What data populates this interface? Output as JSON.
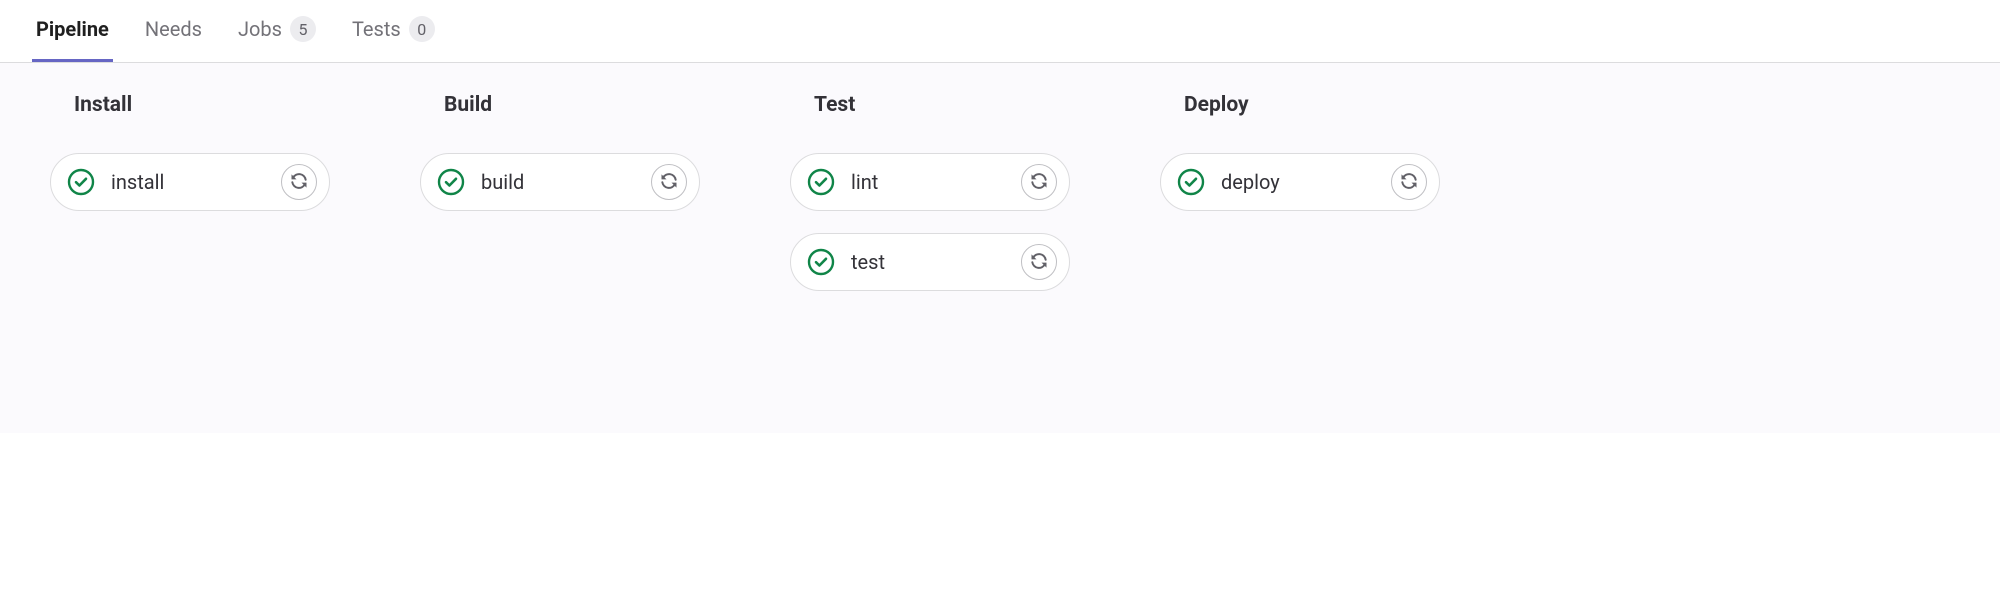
{
  "tabs": [
    {
      "label": "Pipeline",
      "active": true,
      "badge": null
    },
    {
      "label": "Needs",
      "active": false,
      "badge": null
    },
    {
      "label": "Jobs",
      "active": false,
      "badge": "5"
    },
    {
      "label": "Tests",
      "active": false,
      "badge": "0"
    }
  ],
  "stages": [
    {
      "name": "Install",
      "jobs": [
        {
          "name": "install",
          "status": "success"
        }
      ]
    },
    {
      "name": "Build",
      "jobs": [
        {
          "name": "build",
          "status": "success"
        }
      ]
    },
    {
      "name": "Test",
      "jobs": [
        {
          "name": "lint",
          "status": "success"
        },
        {
          "name": "test",
          "status": "success"
        }
      ]
    },
    {
      "name": "Deploy",
      "jobs": [
        {
          "name": "deploy",
          "status": "success"
        }
      ]
    }
  ],
  "colors": {
    "success": "#108548",
    "tab_active_underline": "#6666c4",
    "icon_gray": "#626168"
  }
}
